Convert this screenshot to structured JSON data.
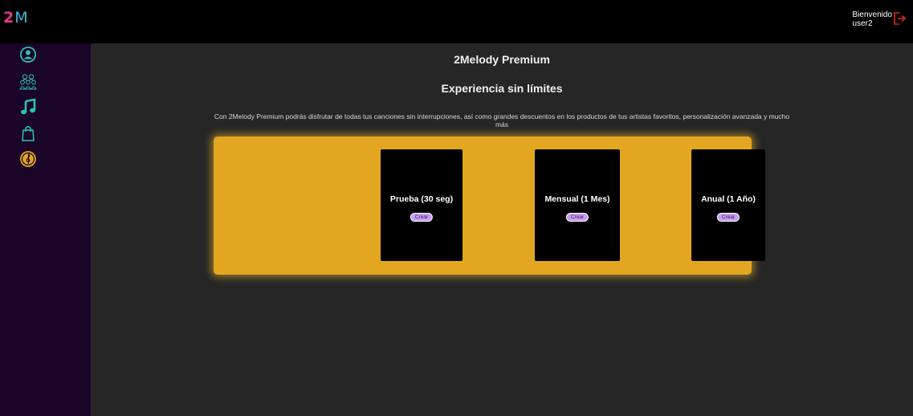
{
  "header": {
    "logo_two": "2",
    "logo_m": "M",
    "welcome_line1": "Bienvenido",
    "welcome_line2": "user2",
    "logout_icon": "logout-icon"
  },
  "sidebar": {
    "items": [
      {
        "name": "profile",
        "icon": "user-circle-icon"
      },
      {
        "name": "community",
        "icon": "group-icon"
      },
      {
        "name": "music",
        "icon": "music-note-icon"
      },
      {
        "name": "shop",
        "icon": "shopping-bag-icon"
      },
      {
        "name": "premium",
        "icon": "treble-clef-icon"
      }
    ]
  },
  "main": {
    "title": "2Melody Premium",
    "subtitle": "Experiencia sin límites",
    "description": "Con 2Melody Premium podrás disfrutar de todas tus canciones sin interrupciones, así como grandes descuentos en los productos de tus artistas favoritos, personalización avanzada y mucho más",
    "plans": [
      {
        "title": "Prueba (30 seg)",
        "button": "Crear"
      },
      {
        "title": "Mensual (1 Mes)",
        "button": "Crear"
      },
      {
        "title": "Anual (1 Año)",
        "button": "Crear"
      }
    ]
  },
  "colors": {
    "topbar": "#000000",
    "sidebar": "#1a0428",
    "background": "#262626",
    "plans_panel": "#e2a620",
    "card": "#000000",
    "button": "#c89cf0",
    "accent_teal": "#2cc3b0",
    "logout_red": "#e0282a"
  }
}
